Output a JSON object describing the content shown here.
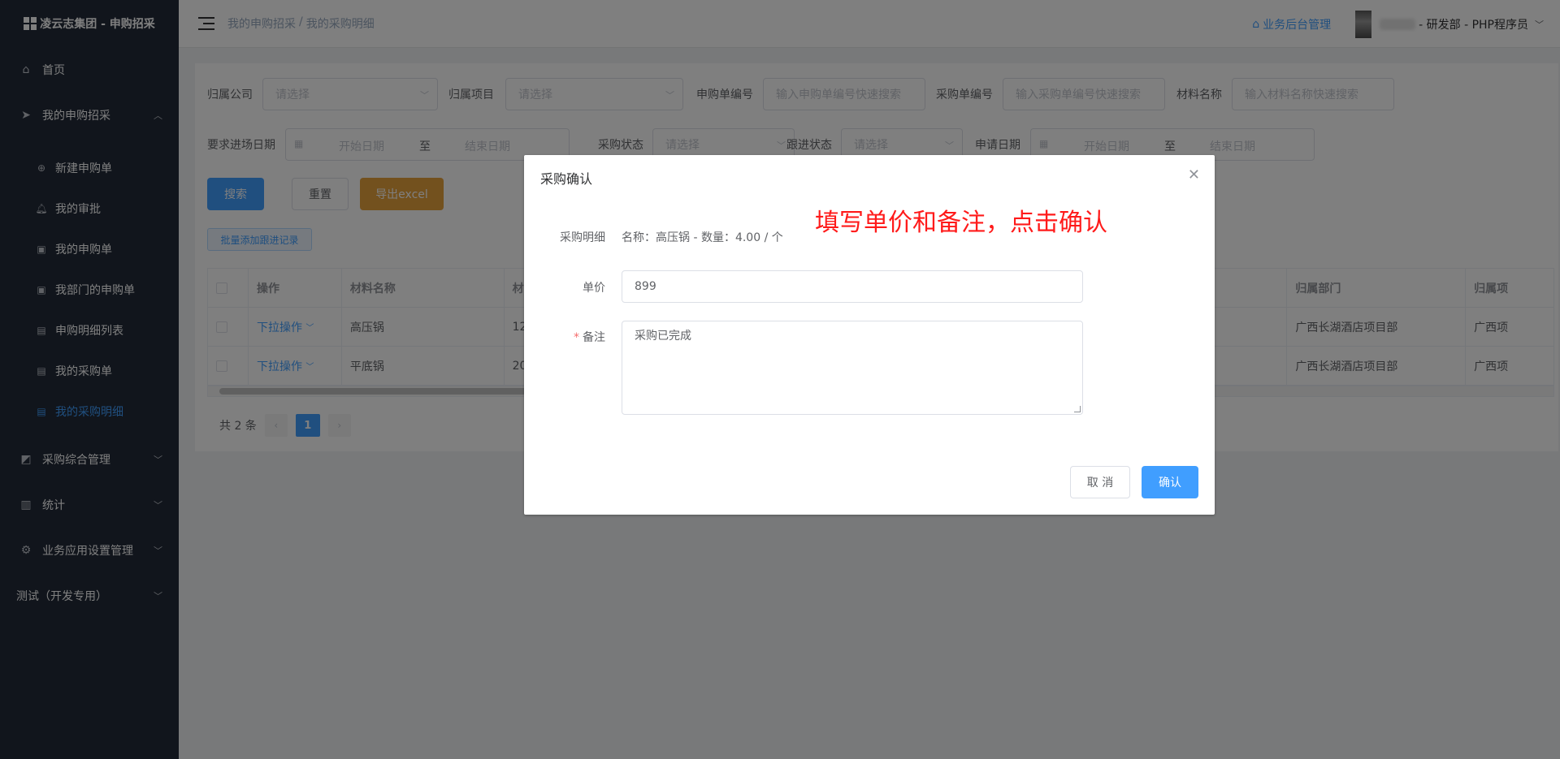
{
  "app": {
    "logo_text": "凌云志集团 - 申购招采"
  },
  "sidebar": {
    "home": "首页",
    "my_procurement": "我的申购招采",
    "sub_items": [
      "新建申购单",
      "我的审批",
      "我的申购单",
      "我部门的申购单",
      "申购明细列表",
      "我的采购单",
      "我的采购明细"
    ],
    "procurement_mgmt": "采购综合管理",
    "stats": "统计",
    "biz_settings": "业务应用设置管理",
    "test": "测试（开发专用）"
  },
  "header": {
    "breadcrumb_1": "我的申购招采",
    "breadcrumb_sep": "/",
    "breadcrumb_2": "我的采购明细",
    "biz_link": "业务后台管理",
    "user_text": "- 研发部 - PHP程序员"
  },
  "filters": {
    "company_label": "归属公司",
    "company_placeholder": "请选择",
    "project_label": "归属项目",
    "project_placeholder": "请选择",
    "req_no_label": "申购单编号",
    "req_no_placeholder": "输入申购单编号快速搜索",
    "po_no_label": "采购单编号",
    "po_no_placeholder": "输入采购单编号快速搜索",
    "material_label": "材料名称",
    "material_placeholder": "输入材料名称快速搜索",
    "entry_date_label": "要求进场日期",
    "start_date": "开始日期",
    "to": "至",
    "end_date": "结束日期",
    "po_status_label": "采购状态",
    "po_status_placeholder": "请选择",
    "follow_status_label": "跟进状态",
    "follow_status_placeholder": "请选择",
    "apply_date_label": "申请日期"
  },
  "buttons": {
    "search": "搜索",
    "reset": "重置",
    "export": "导出excel",
    "batch_add": "批量添加跟进记录"
  },
  "table": {
    "headers": {
      "op": "操作",
      "material": "材料名称",
      "col3": "材",
      "dept": "归属部门",
      "proj": "归属项"
    },
    "rows": [
      {
        "op": "下拉操作",
        "material": "高压锅",
        "col3": "12",
        "dept": "广西长湖酒店项目部",
        "proj": "广西项"
      },
      {
        "op": "下拉操作",
        "material": "平底锅",
        "col3": "20",
        "dept": "广西长湖酒店项目部",
        "proj": "广西项"
      }
    ]
  },
  "pagination": {
    "total": "共 2 条",
    "current": "1"
  },
  "dialog": {
    "title": "采购确认",
    "detail_label": "采购明细",
    "detail_value": "名称：高压锅 - 数量：4.00 / 个",
    "price_label": "单价",
    "price_value": "899",
    "remark_required": "*",
    "remark_label": "备注",
    "remark_value": "采购已完成",
    "cancel": "取 消",
    "confirm": "确认",
    "annotation": "填写单价和备注，点击确认"
  }
}
